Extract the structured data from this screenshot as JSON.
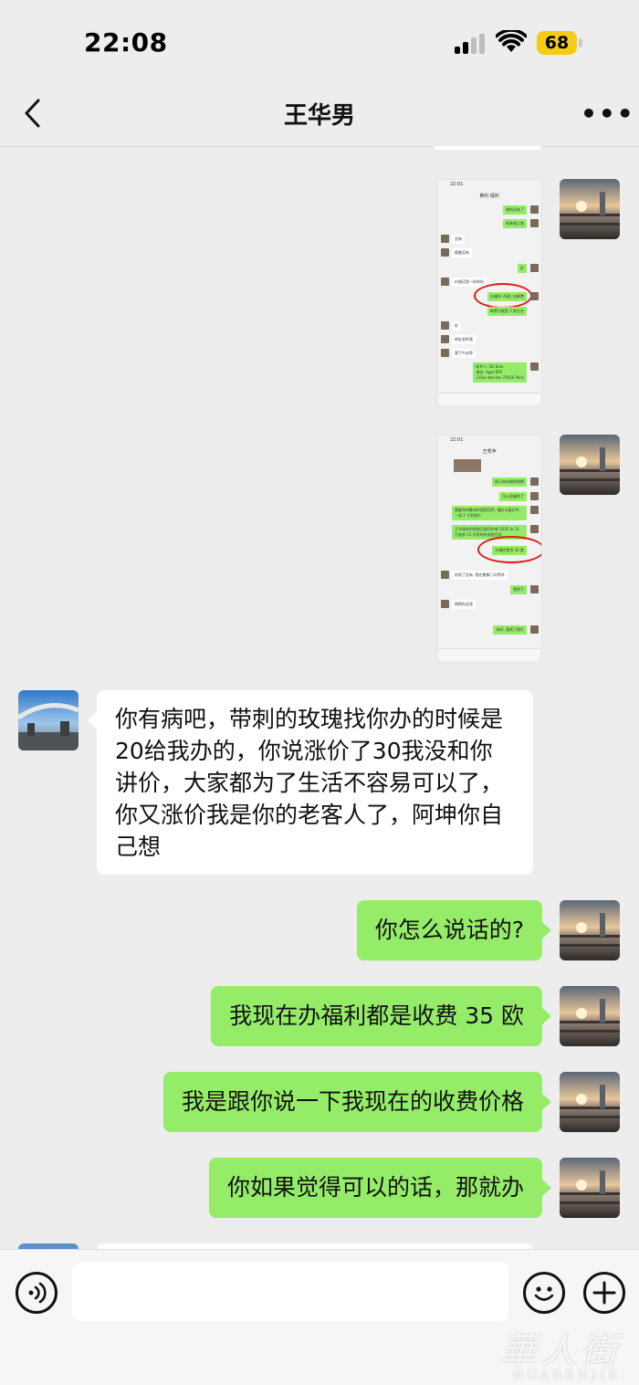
{
  "status_bar": {
    "time": "22:08",
    "battery": "68"
  },
  "nav": {
    "title": "王华男"
  },
  "screenshot1": {
    "time": "22:01",
    "title": "黄利·福利",
    "lines": [
      "我的没有了",
      "给朱瑞工商",
      "没有",
      "随着没有",
      "好",
      "价格还是一样的吗",
      "办福利 35欧, 加邮费",
      "邮费可能是 3 欧左右",
      "好",
      "地址发你我",
      "我下午去寄",
      "收件人: Dù Kuin",
      "地址: Appt 605",
      "3 Rue des Iles 75016 Paris"
    ]
  },
  "screenshot2": {
    "time": "22:01",
    "title": "王秀萍",
    "lines": [
      "提示你的福利到期",
      "可以续福利了",
      "需要你的整本护照首页件, 福利卡复印件, 一张 2 寸的照片",
      "王洪清的护照首页复印件和 2025 年 11 月底前 12 月份的有效居住证",
      "办理的费用 30 欧",
      "你到了没有, 我在紫紫门口等你",
      "我到了",
      "稍稍在这里",
      "你好, 我找了照片"
    ]
  },
  "messages": {
    "in1": "你有病吧，带刺的玫瑰找你办的时候是20给我办的，你说涨价了30我没和你讲价，大家都为了生活不容易可以了，你又涨价我是你的老客人了，阿坤你自己想",
    "out1": "你怎么说话的?",
    "out2": "我现在办福利都是收费 35 欧",
    "out3": "我是跟你说一下我现在的收费价格",
    "out4": "你如果觉得可以的话，那就办"
  },
  "watermark": {
    "line1": "華人街",
    "line2": "HUARENJIE"
  }
}
